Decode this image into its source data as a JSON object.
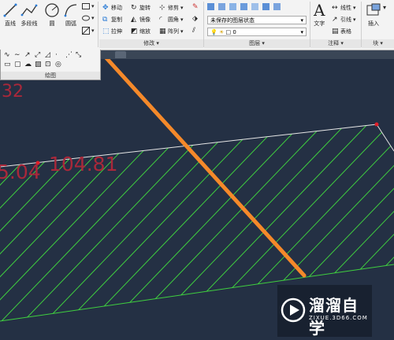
{
  "ribbon": {
    "draw_panel": {
      "line": "直线",
      "polyline": "多段线",
      "circle": "圆",
      "arc": "圆弧",
      "title": "绘图"
    },
    "modify_panel": {
      "move": "移动",
      "rotate": "旋转",
      "trim": "修剪",
      "copy": "复制",
      "mirror": "镜像",
      "fillet": "圆角",
      "stretch": "拉伸",
      "scale": "缩放",
      "array": "阵列",
      "title": "修改"
    },
    "layers_panel": {
      "layer_state": "未保存的图层状态",
      "current_layer": "0",
      "title": "图层"
    },
    "annotation_panel": {
      "text": "文字",
      "linear": "线性",
      "leader": "引线",
      "table": "表格",
      "title": "注释"
    },
    "block_panel": {
      "insert": "插入",
      "title": "块"
    }
  },
  "canvas": {
    "label_top": "32",
    "label_left": "5.04",
    "label_main": "104.81",
    "colors": {
      "background": "#243044",
      "hatch": "#3fcf3f",
      "boundary": "#ffffff",
      "text": "#a9283a",
      "arrow": "#f5892a"
    }
  },
  "watermark": {
    "title": "溜溜自学",
    "url": "ZIXUE.3D66.COM"
  }
}
